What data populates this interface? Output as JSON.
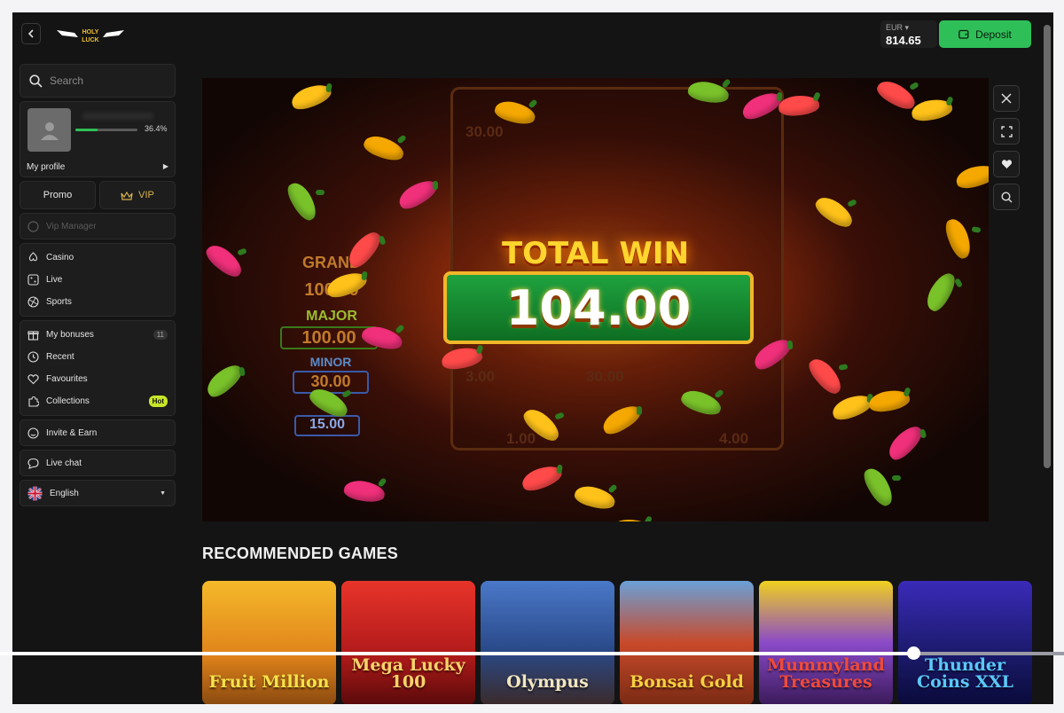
{
  "header": {
    "logo_text": "HOLY LUCK",
    "balance_currency": "EUR",
    "balance_amount": "814.65",
    "deposit_label": "Deposit"
  },
  "sidebar": {
    "search_placeholder": "Search",
    "profile": {
      "progress_label": "36.4%",
      "progress_value": 0.364,
      "my_profile_label": "My profile"
    },
    "promo_label": "Promo",
    "vip_label": "VIP",
    "vip_manager_label": "Vip Manager",
    "nav_main": [
      {
        "label": "Casino",
        "icon": "spade-icon"
      },
      {
        "label": "Live",
        "icon": "dice-icon"
      },
      {
        "label": "Sports",
        "icon": "ball-icon"
      }
    ],
    "nav_user": [
      {
        "label": "My bonuses",
        "icon": "gift-icon",
        "badge": "11"
      },
      {
        "label": "Recent",
        "icon": "clock-icon"
      },
      {
        "label": "Favourites",
        "icon": "heart-icon"
      },
      {
        "label": "Collections",
        "icon": "puzzle-icon",
        "badge": "Hot"
      }
    ],
    "invite_label": "Invite & Earn",
    "live_chat_label": "Live chat",
    "language_label": "English"
  },
  "game": {
    "total_win_label": "TOTAL WIN",
    "total_win_amount": "104.00",
    "reel_values": [
      "30.00",
      "3.00",
      "30.00",
      "1.00",
      "4.00"
    ],
    "jackpots": [
      "GRAND",
      "MAJOR",
      "MINOR",
      "15.00"
    ],
    "jackpot_values": [
      "100.00",
      "100.00",
      "30.00"
    ]
  },
  "recommended": {
    "title": "RECOMMENDED GAMES",
    "games": [
      {
        "name": "Fruit Million"
      },
      {
        "name": "Mega Lucky 100"
      },
      {
        "name": "Olympus"
      },
      {
        "name": "Bonsai Gold"
      },
      {
        "name": "Mummyland Treasures"
      },
      {
        "name": "Thunder Coins XXL"
      }
    ]
  },
  "colors": {
    "accent_green": "#2fbf58",
    "vip_gold": "#d8b349",
    "hot_badge": "#c8e629"
  },
  "video_progress": 0.858
}
